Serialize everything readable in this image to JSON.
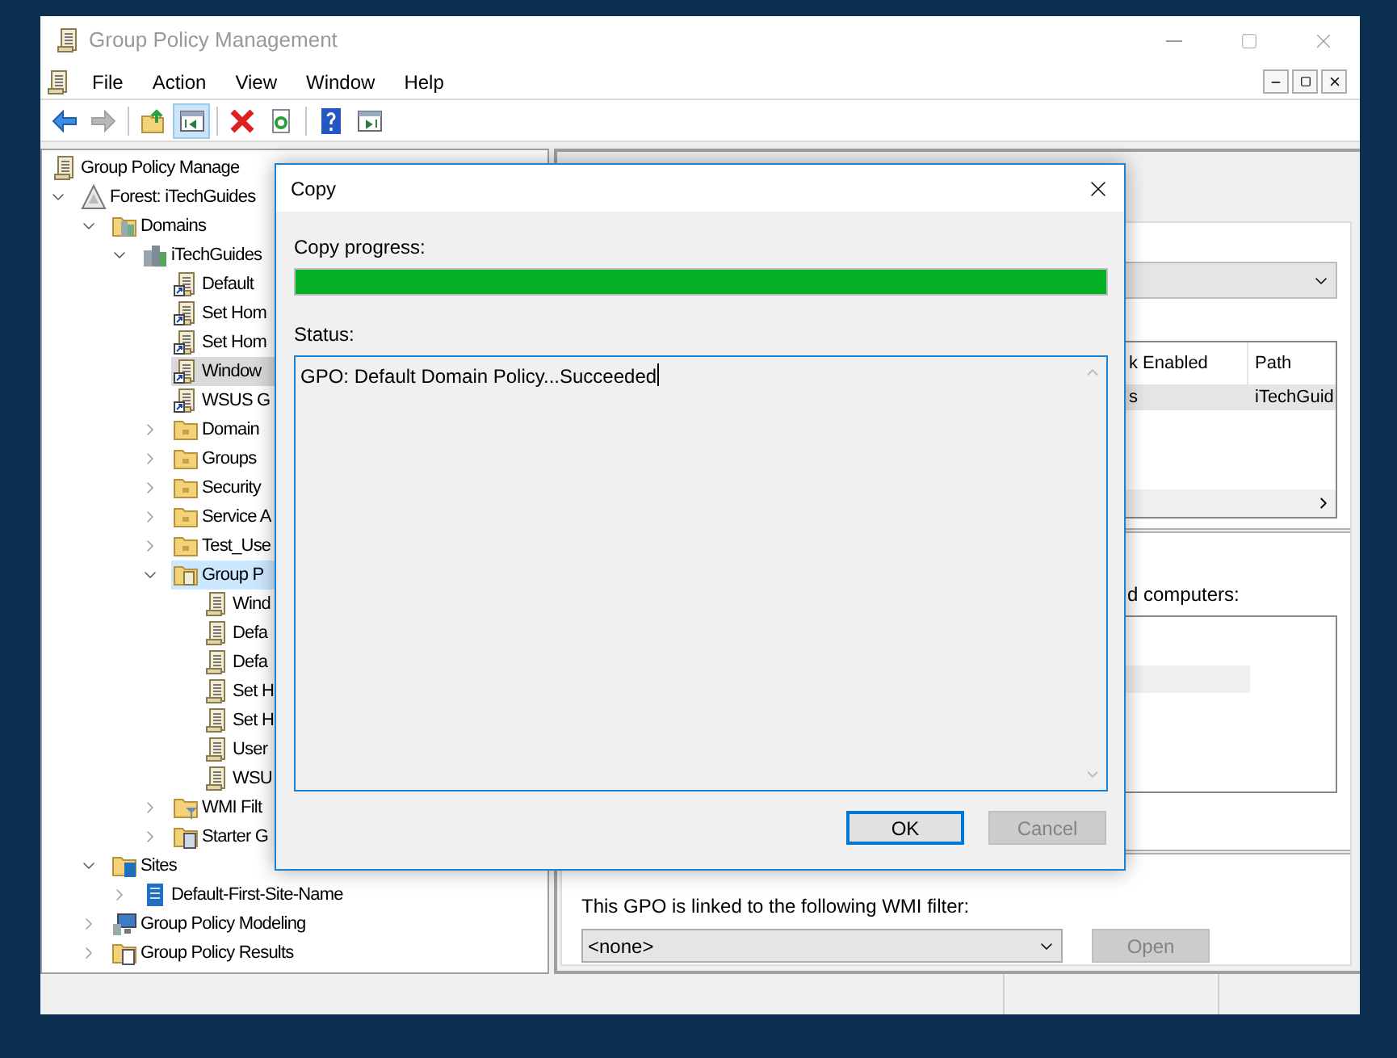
{
  "window": {
    "title": "Group Policy Management"
  },
  "menu": [
    "File",
    "Action",
    "View",
    "Window",
    "Help"
  ],
  "toolbar": [
    {
      "kind": "back",
      "pressed": false,
      "disabled": false
    },
    {
      "kind": "forward",
      "pressed": false,
      "disabled": true
    },
    {
      "kind": "up",
      "pressed": false,
      "disabled": false
    },
    {
      "kind": "tree-toggle",
      "pressed": true,
      "disabled": false
    },
    {
      "kind": "delete",
      "pressed": false,
      "disabled": false
    },
    {
      "kind": "refresh",
      "pressed": false,
      "disabled": false
    },
    {
      "kind": "help",
      "pressed": false,
      "disabled": false
    },
    {
      "kind": "action-pane",
      "pressed": false,
      "disabled": false
    }
  ],
  "tree": [
    {
      "label": "Group Policy Manage",
      "kind": "root",
      "selected": false,
      "hovered": false,
      "children": [
        {
          "label": "Forest: iTechGuides",
          "kind": "forest",
          "expanded": true,
          "selected": false,
          "hovered": false,
          "children": [
            {
              "label": "Domains",
              "kind": "domains",
              "expanded": true,
              "selected": false,
              "hovered": false,
              "children": [
                {
                  "label": "iTechGuides",
                  "kind": "domain",
                  "expanded": true,
                  "selected": false,
                  "hovered": false,
                  "children": [
                    {
                      "label": "Default",
                      "kind": "gpo-link",
                      "selected": false,
                      "hovered": false
                    },
                    {
                      "label": "Set Hom",
                      "kind": "gpo-link",
                      "selected": false,
                      "hovered": false
                    },
                    {
                      "label": "Set Hom",
                      "kind": "gpo-link",
                      "selected": false,
                      "hovered": false
                    },
                    {
                      "label": "Window",
                      "kind": "gpo-link",
                      "selected": true,
                      "hovered": false
                    },
                    {
                      "label": "WSUS G",
                      "kind": "gpo-link",
                      "selected": false,
                      "hovered": false
                    },
                    {
                      "label": "Domain",
                      "kind": "folder",
                      "expanded": false,
                      "selected": false,
                      "hovered": false
                    },
                    {
                      "label": "Groups",
                      "kind": "folder",
                      "expanded": false,
                      "selected": false,
                      "hovered": false
                    },
                    {
                      "label": "Security",
                      "kind": "folder",
                      "expanded": false,
                      "selected": false,
                      "hovered": false
                    },
                    {
                      "label": "Service A",
                      "kind": "folder",
                      "expanded": false,
                      "selected": false,
                      "hovered": false
                    },
                    {
                      "label": "Test_Use",
                      "kind": "folder",
                      "expanded": false,
                      "selected": false,
                      "hovered": false
                    },
                    {
                      "label": "Group P",
                      "kind": "gpo-folder",
                      "expanded": true,
                      "selected": false,
                      "hovered": true,
                      "children": [
                        {
                          "label": "Wind",
                          "kind": "gpo",
                          "selected": false,
                          "hovered": false
                        },
                        {
                          "label": "Defa",
                          "kind": "gpo",
                          "selected": false,
                          "hovered": false
                        },
                        {
                          "label": "Defa",
                          "kind": "gpo",
                          "selected": false,
                          "hovered": false
                        },
                        {
                          "label": "Set H",
                          "kind": "gpo",
                          "selected": false,
                          "hovered": false
                        },
                        {
                          "label": "Set H",
                          "kind": "gpo",
                          "selected": false,
                          "hovered": false
                        },
                        {
                          "label": "User",
                          "kind": "gpo",
                          "selected": false,
                          "hovered": false
                        },
                        {
                          "label": "WSU",
                          "kind": "gpo",
                          "selected": false,
                          "hovered": false
                        }
                      ]
                    },
                    {
                      "label": "WMI Filt",
                      "kind": "filter-folder",
                      "expanded": false,
                      "selected": false,
                      "hovered": false
                    },
                    {
                      "label": "Starter G",
                      "kind": "starter-folder",
                      "expanded": false,
                      "selected": false,
                      "hovered": false
                    }
                  ]
                }
              ]
            },
            {
              "label": "Sites",
              "kind": "sites",
              "expanded": true,
              "selected": false,
              "hovered": false,
              "children": [
                {
                  "label": "Default-First-Site-Name",
                  "kind": "site",
                  "expanded": false,
                  "selected": false,
                  "hovered": false
                }
              ]
            },
            {
              "label": "Group Policy Modeling",
              "kind": "modeling",
              "expanded": false,
              "selected": false,
              "hovered": false
            },
            {
              "label": "Group Policy Results",
              "kind": "results",
              "expanded": false,
              "selected": false,
              "hovered": false
            }
          ]
        }
      ]
    }
  ],
  "details": {
    "columns": [
      "k Enabled",
      "Path"
    ],
    "rows": [
      [
        "s",
        "iTechGuid"
      ]
    ],
    "security_label": "d computers:",
    "wmi": {
      "label": "This GPO is linked to the following WMI filter:",
      "value": "<none>",
      "open_button": {
        "label": "Open",
        "disabled": true
      }
    }
  },
  "dialog": {
    "title": "Copy",
    "progress_label": "Copy progress:",
    "progress": {
      "level": 1
    },
    "status_label": "Status:",
    "status_text": "GPO: Default Domain Policy...Succeeded",
    "buttons": [
      {
        "label": "OK",
        "default": true,
        "disabled": false
      },
      {
        "label": "Cancel",
        "default": false,
        "disabled": true
      }
    ]
  }
}
